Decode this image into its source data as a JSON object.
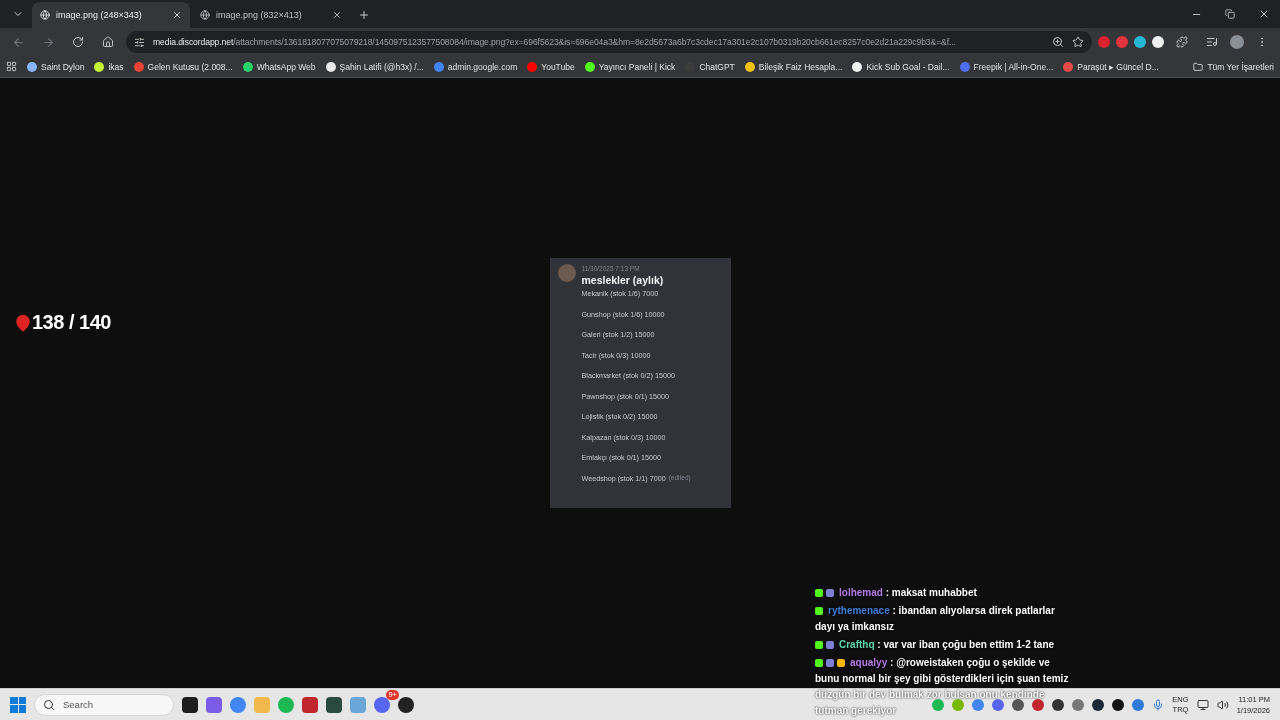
{
  "browser": {
    "tabs": [
      {
        "title": "image.png (248×343)",
        "selected": true
      },
      {
        "title": "image.png (832×413)",
        "selected": false
      }
    ],
    "url": {
      "host": "media.discordapp.net",
      "path": "/attachments/1361818077075079218/1450975123577508084/image.png?ex=696f5623&is=696e04a3&hm=8e2d5673a6b7c3cdec17a301e2c107b0319b20cb661ec8257c0e2d21a229c9b3&=&f..."
    },
    "bookmarks": [
      {
        "label": "Saint Dylon",
        "color": "#8ab4f8"
      },
      {
        "label": "ikas",
        "color": "#c6f432"
      },
      {
        "label": "Gelen Kutusu (2.008...",
        "color": "#ea4335"
      },
      {
        "label": "WhatsApp Web",
        "color": "#25d366"
      },
      {
        "label": "Şahin Latifi (@h3x) /...",
        "color": "#e8e8e8"
      },
      {
        "label": "admin.google.com",
        "color": "#4285f4"
      },
      {
        "label": "YouTube",
        "color": "#ff0000"
      },
      {
        "label": "Yayıncı Paneli | Kick",
        "color": "#53fc18"
      },
      {
        "label": "ChatGPT",
        "color": "#3c3c3c"
      },
      {
        "label": "Bileşik Faiz Hesapla...",
        "color": "#f4c20d"
      },
      {
        "label": "Kick Sub Goal - Dail...",
        "color": "#f0f0f0"
      },
      {
        "label": "Freepik | All-in-One...",
        "color": "#4d6ef0"
      },
      {
        "label": "Paraşüt ▸ Güncel D...",
        "color": "#e34b4b"
      }
    ],
    "bookmarks_folder": "Tüm Yer İşaretleri"
  },
  "overlay": {
    "counter": "138 / 140"
  },
  "image": {
    "timestamp": "11/30/2025 7:13 PM",
    "title": "meslekler (aylık)",
    "note": "(edited)",
    "lines": [
      "Mekanik (stok 1/6) 7000",
      "Gunshop (stok 1/6) 10000",
      "Galeri (stok 1/2) 15000",
      "Tacir (stok 0/3) 10000",
      "Blackmarket (stok 0/2) 15000",
      "Pawnshop (stok 0/1) 15000",
      "Lojistik (stok 0/2) 15000",
      "Kalpazan (stok 0/3) 10000",
      "Emlakçı (stok 0/1) 15000",
      "Weedshop (stok 1/1) 7000"
    ]
  },
  "chat": [
    {
      "user": "lolhemad",
      "color": "#b77ce6",
      "badges": [
        {
          "kind": "kick"
        },
        {
          "kind": "sub"
        }
      ],
      "message": ": maksat muhabbet"
    },
    {
      "user": "rythemenace",
      "color": "#3f7fd9",
      "badges": [
        {
          "kind": "kick"
        }
      ],
      "message": ": ibandan alıyolarsa direk patlarlar dayı ya imkansız"
    },
    {
      "user": "Crafthq",
      "color": "#5fd7b0",
      "badges": [
        {
          "kind": "kick"
        },
        {
          "kind": "sub"
        }
      ],
      "message": ": var var iban çoğu ben ettim 1-2 tane"
    },
    {
      "user": "aqualyy",
      "color": "#b77ce6",
      "badges": [
        {
          "kind": "kick"
        },
        {
          "kind": "sub"
        },
        {
          "kind": "coin"
        }
      ],
      "message": ": @roweistaken çoğu o şekilde ve bunu normal bir şey gibi gösterdikleri için şuan temiz düzgün bir dev bulmak zor bulsan onu kendinde tutman gerekiyor"
    }
  ],
  "taskbar": {
    "search_placeholder": "Search",
    "discord_badge": "9+",
    "language": "ENG",
    "keyboard": "TRQ",
    "time": "11:01 PM",
    "date": "1/19/2026"
  }
}
